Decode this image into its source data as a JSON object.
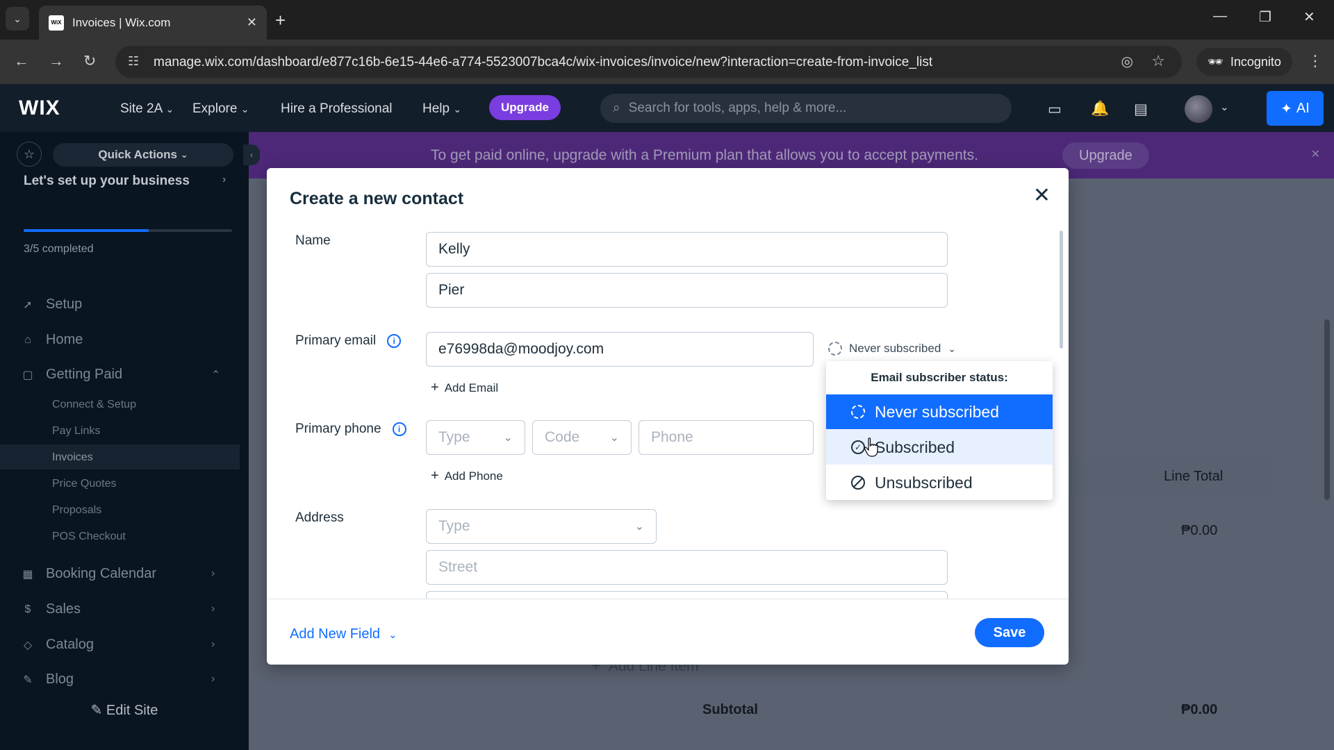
{
  "browser": {
    "tab_title": "Invoices | Wix.com",
    "url": "manage.wix.com/dashboard/e877c16b-6e15-44e6-a774-5523007bca4c/wix-invoices/invoice/new?interaction=create-from-invoice_list",
    "incognito_label": "Incognito"
  },
  "topbar": {
    "logo": "WIX",
    "site": "Site 2A",
    "explore": "Explore",
    "hire": "Hire a Professional",
    "help": "Help",
    "upgrade": "Upgrade",
    "search_placeholder": "Search for tools, apps, help & more...",
    "ai_label": "AI"
  },
  "sidebar": {
    "quick_actions": "Quick Actions",
    "setup_title": "Let's set up your business",
    "progress_text": "3/5 completed",
    "progress_fraction": 0.6,
    "items": {
      "setup": "Setup",
      "home": "Home",
      "getting_paid": "Getting Paid",
      "booking": "Booking Calendar",
      "sales": "Sales",
      "catalog": "Catalog",
      "blog": "Blog"
    },
    "subitems": {
      "connect": "Connect & Setup",
      "pay_links": "Pay Links",
      "invoices": "Invoices",
      "price_quotes": "Price Quotes",
      "proposals": "Proposals",
      "pos": "POS Checkout"
    },
    "edit_site": "Edit Site"
  },
  "banner": {
    "message": "To get paid online, upgrade with a Premium plan that allows you to accept payments.",
    "upgrade": "Upgrade"
  },
  "background": {
    "line_total": "Line Total",
    "amount_1": "₱0.00",
    "add_line_item": "Add Line Item",
    "subtotal": "Subtotal",
    "subtotal_amount": "₱0.00"
  },
  "modal": {
    "title": "Create a new contact",
    "name_label": "Name",
    "first_name": "Kelly",
    "last_name": "Pier",
    "email_label": "Primary email",
    "email_value": "e76998da@moodjoy.com",
    "subscription_status": "Never subscribed",
    "add_email": "Add Email",
    "phone_label": "Primary phone",
    "phone_type": "Type",
    "phone_code": "Code",
    "phone_placeholder": "Phone",
    "add_phone": "Add Phone",
    "address_label": "Address",
    "address_type": "Type",
    "street_placeholder": "Street",
    "add_new_field": "Add New Field",
    "save": "Save"
  },
  "dropdown": {
    "header": "Email subscriber status:",
    "options": [
      "Never subscribed",
      "Subscribed",
      "Unsubscribed"
    ],
    "selected": "Never subscribed"
  },
  "colors": {
    "accent": "#116dff",
    "upgrade_purple": "#7a3de0",
    "banner_purple": "#4d2878",
    "topbar": "#131e2b",
    "sidebar": "#0a1522"
  }
}
